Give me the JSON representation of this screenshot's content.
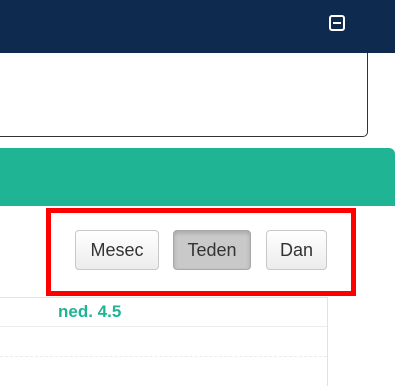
{
  "header": {
    "collapse_icon": "minus-square-icon"
  },
  "calendar": {
    "views": {
      "month_label": "Mesec",
      "week_label": "Teden",
      "day_label": "Dan",
      "active": "week"
    },
    "columns": [
      {
        "label": "ned. 4.5"
      }
    ]
  },
  "colors": {
    "header_bg": "#0e2a4f",
    "accent": "#1fb494",
    "highlight": "#ff0000"
  }
}
